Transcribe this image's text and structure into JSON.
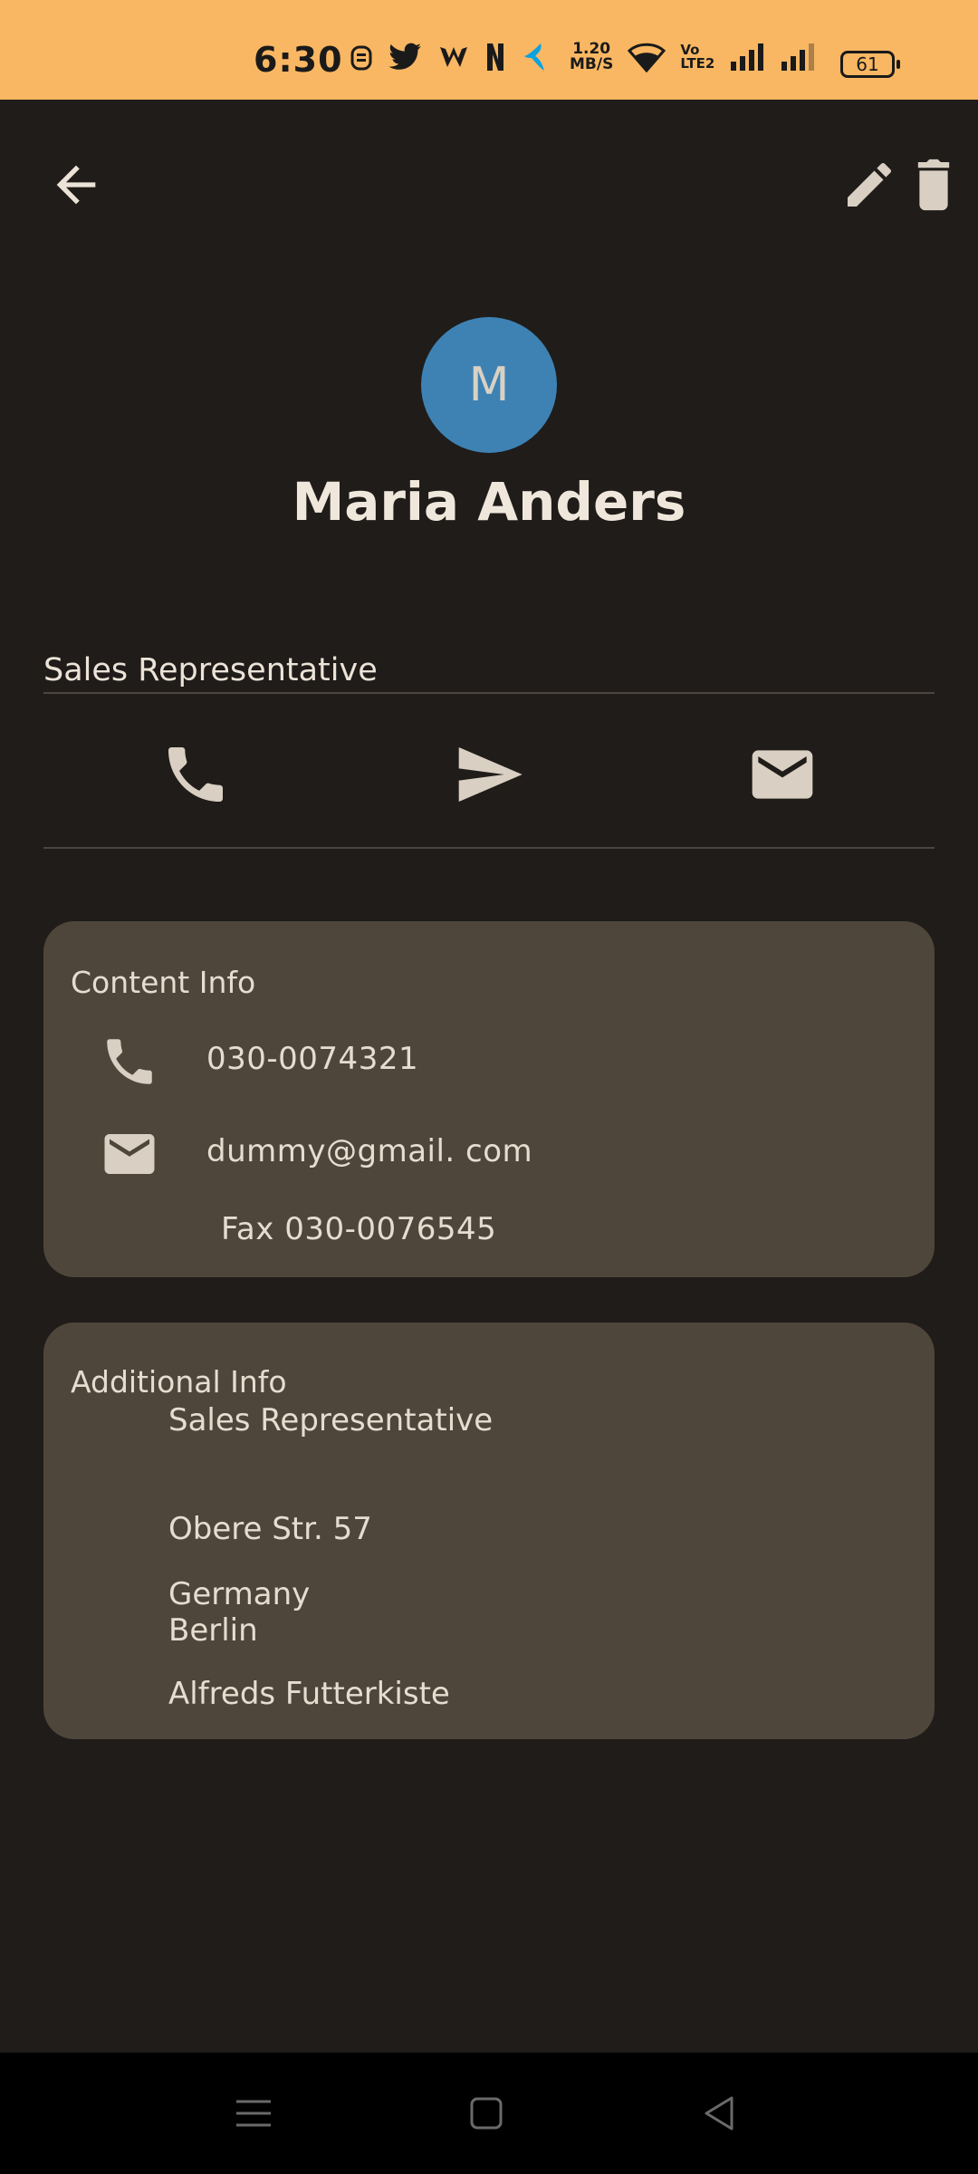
{
  "status_bar": {
    "time": "6:30",
    "net_speed_value": "1.20",
    "net_speed_unit": "MB/S",
    "volte_top": "Vo",
    "volte_bottom": "LTE2",
    "battery": "61",
    "background": "#f9b763"
  },
  "toolbar": {
    "back_icon": "arrow-back-icon",
    "edit_icon": "pencil-icon",
    "delete_icon": "trash-icon"
  },
  "profile": {
    "avatar_initial": "M",
    "avatar_color": "#3e82b4",
    "name": "Maria Anders",
    "job_title": "Sales Representative"
  },
  "actions": [
    {
      "icon": "phone-icon"
    },
    {
      "icon": "send-icon"
    },
    {
      "icon": "mail-icon"
    }
  ],
  "contact_info": {
    "title": "Content Info",
    "phone": "030-0074321",
    "email": "dummy@gmail. com",
    "fax": "Fax 030-0076545"
  },
  "additional_info": {
    "title": "Additional Info",
    "lines": [
      "Sales Representative",
      "Obere Str.  57",
      "Germany",
      "Berlin",
      "Alfreds Futterkiste"
    ]
  },
  "colors": {
    "background": "#1f1c19",
    "card": "#4f463b",
    "text": "#e8dfd4"
  }
}
